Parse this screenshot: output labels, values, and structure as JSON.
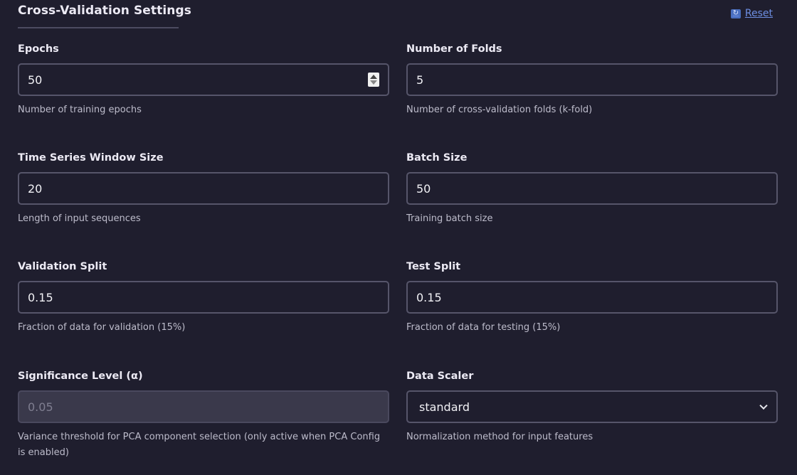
{
  "header": {
    "title": "Cross-Validation Settings",
    "reset_label": "Reset",
    "reset_icon": "refresh-icon"
  },
  "fields": {
    "epochs": {
      "label": "Epochs",
      "value": "50",
      "help": "Number of training epochs"
    },
    "folds": {
      "label": "Number of Folds",
      "value": "5",
      "help": "Number of cross-validation folds (k-fold)"
    },
    "window": {
      "label": "Time Series Window Size",
      "value": "20",
      "help": "Length of input sequences"
    },
    "batch": {
      "label": "Batch Size",
      "value": "50",
      "help": "Training batch size"
    },
    "val_split": {
      "label": "Validation Split",
      "value": "0.15",
      "help": "Fraction of data for validation (15%)"
    },
    "test_split": {
      "label": "Test Split",
      "value": "0.15",
      "help": "Fraction of data for testing (15%)"
    },
    "alpha": {
      "label": "Significance Level (α)",
      "value": "0.05",
      "help": "Variance threshold for PCA component selection (only active when PCA Config is enabled)",
      "disabled": true
    },
    "scaler": {
      "label": "Data Scaler",
      "value": "standard",
      "help": "Normalization method for input features"
    }
  },
  "colors": {
    "background": "#1f1e2e",
    "border": "#56556a",
    "link": "#6d8ee2",
    "disabled_bg": "#3a394b"
  }
}
